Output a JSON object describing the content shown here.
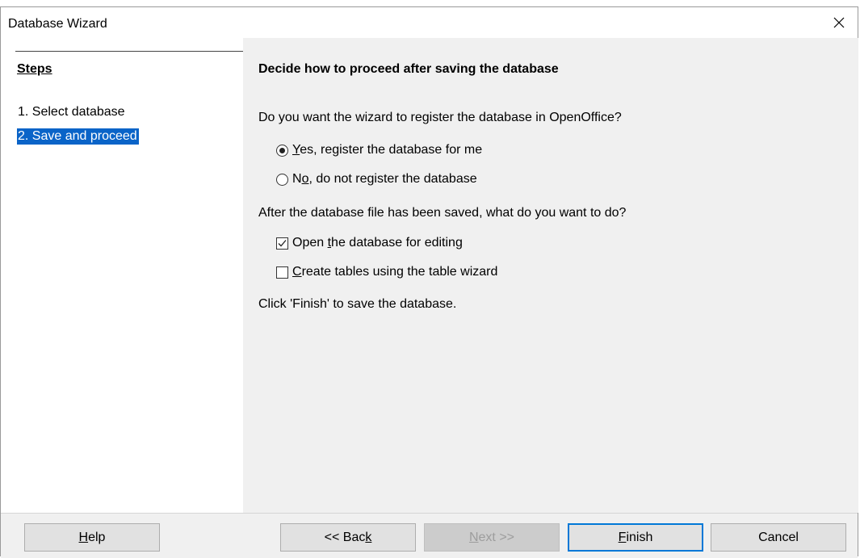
{
  "window": {
    "title": "Database Wizard"
  },
  "steps": {
    "heading": "Steps",
    "items": [
      {
        "label": "1. Select database",
        "selected": false
      },
      {
        "label": "2. Save and proceed",
        "selected": true
      }
    ]
  },
  "content": {
    "title": "Decide how to proceed after saving the database",
    "register_question": "Do you want the wizard to register the database in OpenOffice?",
    "register_options": [
      {
        "mnemonic": "Y",
        "rest": "es, register the database for me",
        "checked": true
      },
      {
        "pre": "N",
        "mnemonic": "o",
        "rest": ", do not register the database",
        "checked": false
      }
    ],
    "after_question": "After the database file has been saved, what do you want to do?",
    "after_options": [
      {
        "pre": "Open ",
        "mnemonic": "t",
        "rest": "he database for editing",
        "checked": true
      },
      {
        "mnemonic": "C",
        "rest": "reate tables using the table wizard",
        "checked": false
      }
    ],
    "finish_note": "Click 'Finish' to save the database."
  },
  "buttons": {
    "help": {
      "mnemonic": "H",
      "rest": "elp"
    },
    "back": {
      "pre": "<< Bac",
      "mnemonic": "k"
    },
    "next": {
      "mnemonic": "N",
      "rest": "ext >>",
      "disabled": true
    },
    "finish": {
      "mnemonic": "F",
      "rest": "inish",
      "default": true
    },
    "cancel": {
      "label": "Cancel"
    }
  },
  "colors": {
    "selection": "#0a64c8",
    "panel_bg": "#f0f0f0",
    "default_button_border": "#0078d7"
  }
}
